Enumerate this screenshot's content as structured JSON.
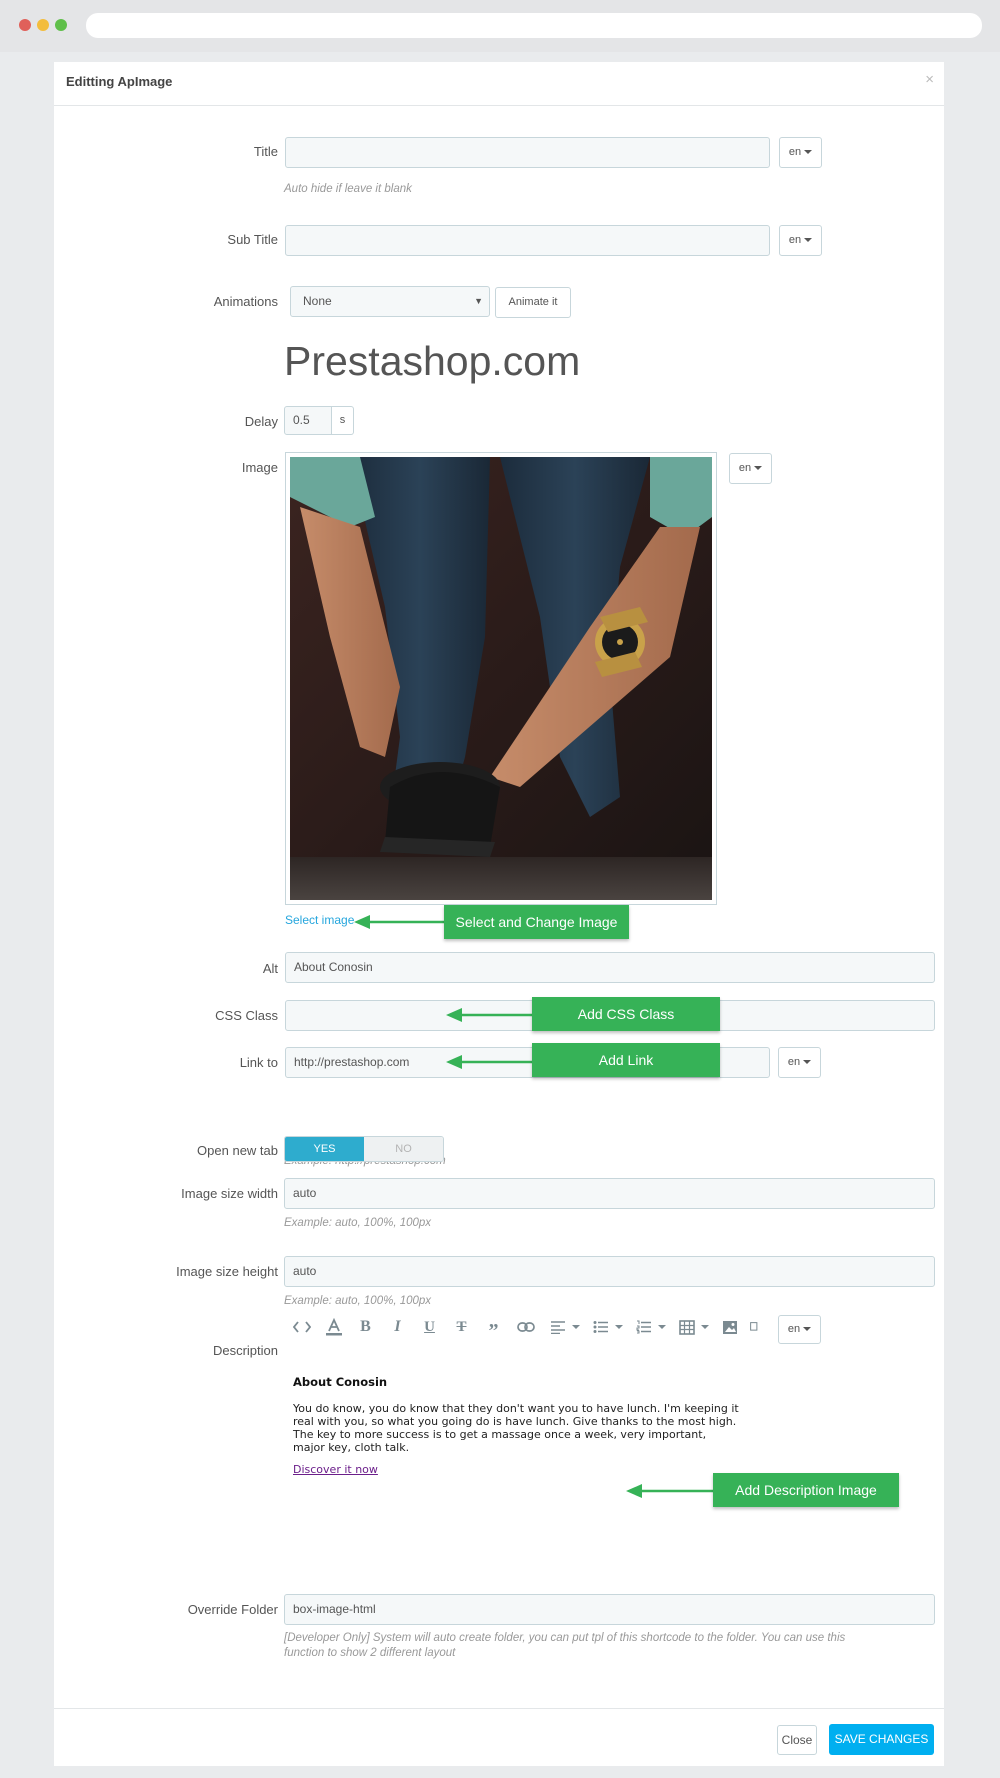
{
  "modal": {
    "title": "Editting ApImage",
    "close_symbol": "×"
  },
  "fields": {
    "title_label": "Title",
    "title_value": "",
    "title_help": "Auto hide if leave it blank",
    "subtitle_label": "Sub Title",
    "subtitle_value": "",
    "animations_label": "Animations",
    "animations_selected": "None",
    "animate_button": "Animate it",
    "preview_text": "Prestashop.com",
    "delay_label": "Delay",
    "delay_value": "0.5",
    "delay_unit": "s",
    "image_label": "Image",
    "select_image_link": "Select image",
    "alt_label": "Alt",
    "alt_value": "About Conosin",
    "css_class_label": "CSS Class",
    "css_class_value": "",
    "link_label": "Link to",
    "link_value": "http://prestashop.com",
    "link_help": "Example: http://prestashop.com",
    "open_new_tab_label": "Open new tab",
    "yes_label": "YES",
    "no_label": "NO",
    "width_label": "Image size width",
    "width_value": "auto",
    "width_help": "Example: auto, 100%, 100px",
    "height_label": "Image size height",
    "height_value": "auto",
    "height_help": "Example: auto, 100%, 100px",
    "description_label": "Description",
    "override_label": "Override Folder",
    "override_value": "box-image-html",
    "override_help_1": "[Developer Only] System will auto create folder, you can put tpl of this shortcode to the folder. You can use this",
    "override_help_2": "function to show 2 different layout"
  },
  "lang": "en",
  "description_content": {
    "heading": "About Conosin",
    "line1": "You do know, you do know that they don't want you to have lunch. I'm keeping it",
    "line2": "real with you, so what you going do is have lunch. Give thanks to the most high.",
    "line3": "The key to more success is to get a massage once a week, very important,",
    "line4": "major key, cloth talk.",
    "link": "Discover it now"
  },
  "callouts": {
    "select_image": "Select and Change Image",
    "css_class": "Add CSS Class",
    "link": "Add Link",
    "description": "Add Description Image"
  },
  "footer": {
    "close": "Close",
    "save": "SAVE CHANGES"
  },
  "toolbar_icons": [
    "code-icon",
    "text-color-icon",
    "bold-icon",
    "italic-icon",
    "underline-icon",
    "strikethrough-icon",
    "blockquote-icon",
    "link-icon",
    "align-icon",
    "bullet-list-icon",
    "numbered-list-icon",
    "table-icon",
    "image-icon",
    "copy-icon"
  ],
  "colors": {
    "accent": "#00aff0",
    "toggle_on": "#2eacce",
    "callout": "#36b257",
    "link": "#25a6dd"
  }
}
